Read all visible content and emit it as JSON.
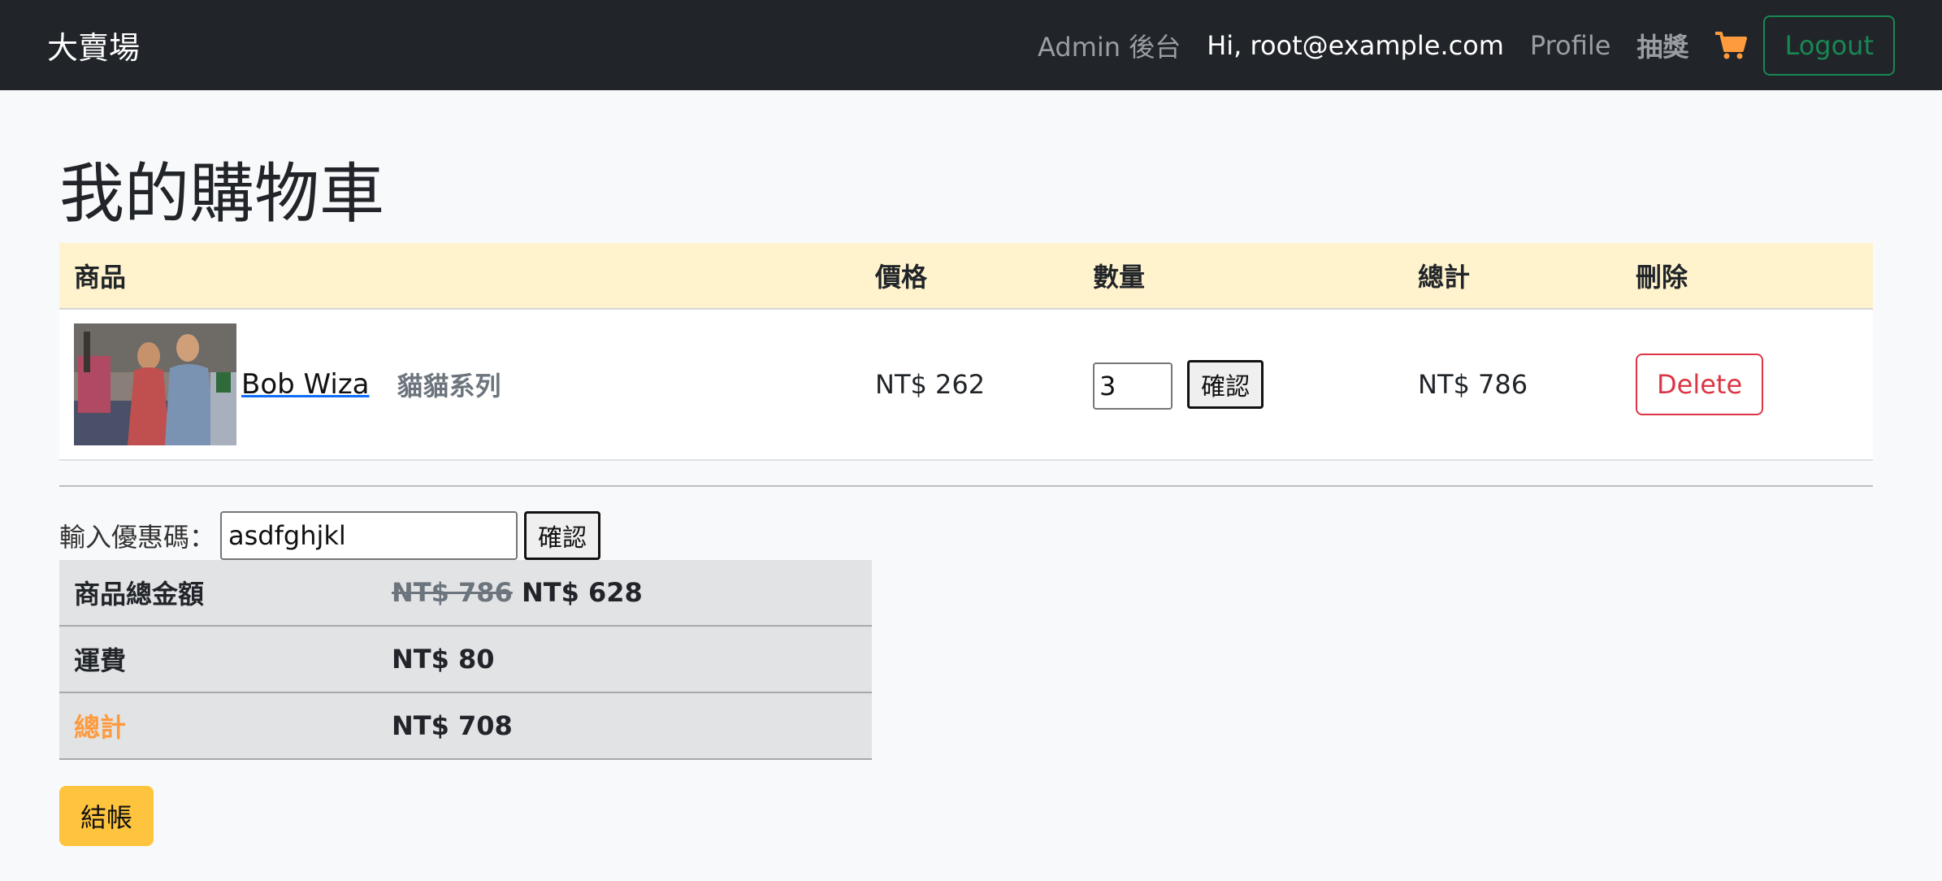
{
  "navbar": {
    "brand": "大賣場",
    "admin_link": "Admin 後台",
    "user_greeting": "Hi, root@example.com",
    "profile_link": "Profile",
    "lottery_link": "抽獎",
    "cart_icon": "shopping-cart-icon",
    "logout_label": "Logout"
  },
  "page": {
    "title": "我的購物車"
  },
  "cart_table": {
    "headers": {
      "product": "商品",
      "price": "價格",
      "quantity": "數量",
      "total": "總計",
      "delete": "刪除"
    },
    "rows": [
      {
        "product_name": "Bob Wiza",
        "series": "貓貓系列",
        "price": "NT$ 262",
        "quantity": "3",
        "confirm_label": "確認",
        "subtotal": "NT$ 786",
        "delete_label": "Delete"
      }
    ]
  },
  "coupon": {
    "label": "輸入優惠碼：",
    "value": "asdfghjkl",
    "confirm_label": "確認"
  },
  "summary": {
    "items_total_label": "商品總金額",
    "original_total": "NT$ 786",
    "discounted_total": "NT$ 628",
    "shipping_label": "運費",
    "shipping_value": "NT$ 80",
    "grand_total_label": "總計",
    "grand_total_value": "NT$ 708"
  },
  "checkout_label": "結帳",
  "colors": {
    "navbar_bg": "#212529",
    "table_header_bg": "#fff3cd",
    "summary_bg": "#e2e3e5",
    "logout_green": "#198754",
    "delete_red": "#dc3545",
    "cart_orange": "#fd9b3e",
    "checkout_yellow": "#ffc43d"
  }
}
